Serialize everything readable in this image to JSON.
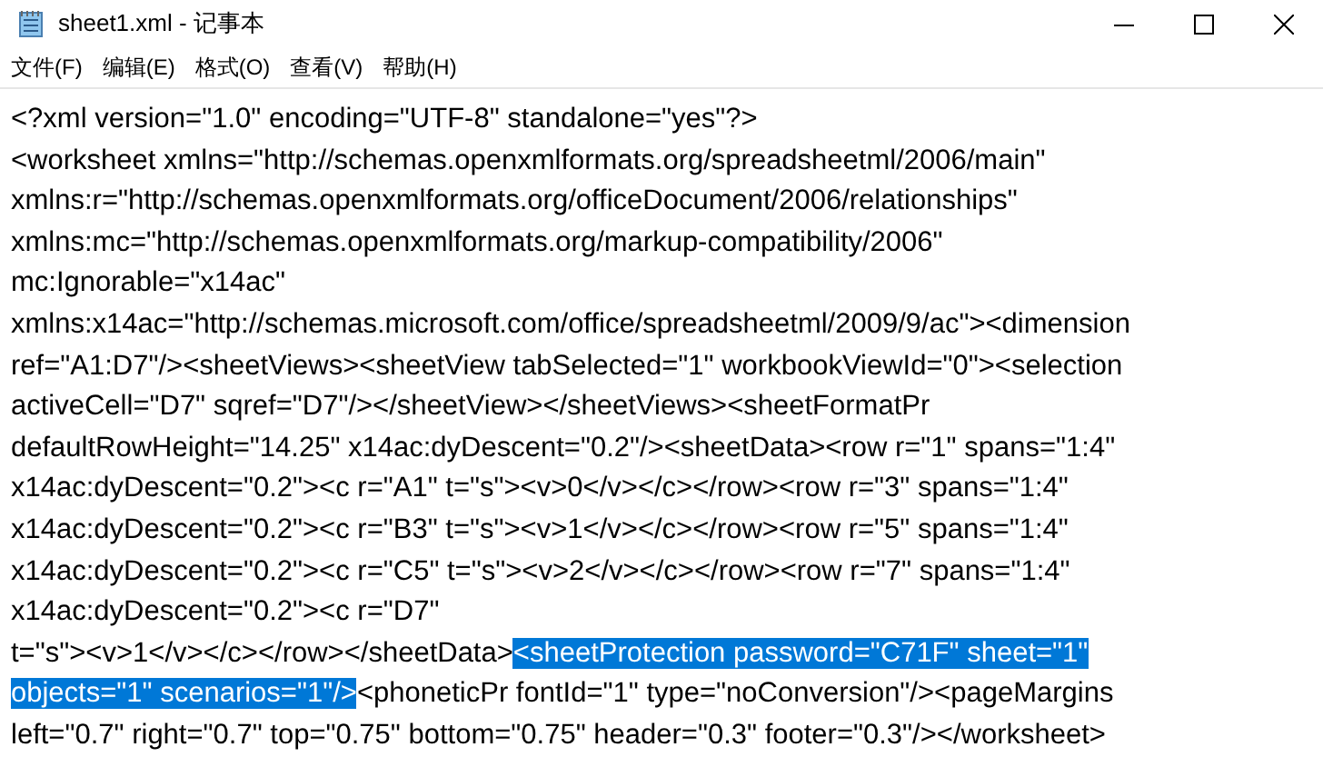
{
  "window": {
    "title": "sheet1.xml - 记事本"
  },
  "menu": [
    {
      "label": "文件(F)"
    },
    {
      "label": "编辑(E)"
    },
    {
      "label": "格式(O)"
    },
    {
      "label": "查看(V)"
    },
    {
      "label": "帮助(H)"
    }
  ],
  "lines": [
    [
      {
        "text": "<?xml version=\"1.0\" encoding=\"UTF-8\" standalone=\"yes\"?>",
        "selected": false
      }
    ],
    [
      {
        "text": "<worksheet xmlns=\"http://schemas.openxmlformats.org/spreadsheetml/2006/main\"",
        "selected": false
      }
    ],
    [
      {
        "text": "xmlns:r=\"http://schemas.openxmlformats.org/officeDocument/2006/relationships\"",
        "selected": false
      }
    ],
    [
      {
        "text": "xmlns:mc=\"http://schemas.openxmlformats.org/markup-compatibility/2006\"",
        "selected": false
      }
    ],
    [
      {
        "text": "mc:Ignorable=\"x14ac\"",
        "selected": false
      }
    ],
    [
      {
        "text": "xmlns:x14ac=\"http://schemas.microsoft.com/office/spreadsheetml/2009/9/ac\"><dimension",
        "selected": false
      }
    ],
    [
      {
        "text": "ref=\"A1:D7\"/><sheetViews><sheetView tabSelected=\"1\" workbookViewId=\"0\"><selection",
        "selected": false
      }
    ],
    [
      {
        "text": "activeCell=\"D7\" sqref=\"D7\"/></sheetView></sheetViews><sheetFormatPr",
        "selected": false
      }
    ],
    [
      {
        "text": "defaultRowHeight=\"14.25\" x14ac:dyDescent=\"0.2\"/><sheetData><row r=\"1\" spans=\"1:4\"",
        "selected": false
      }
    ],
    [
      {
        "text": "x14ac:dyDescent=\"0.2\"><c r=\"A1\" t=\"s\"><v>0</v></c></row><row r=\"3\" spans=\"1:4\"",
        "selected": false
      }
    ],
    [
      {
        "text": "x14ac:dyDescent=\"0.2\"><c r=\"B3\" t=\"s\"><v>1</v></c></row><row r=\"5\" spans=\"1:4\"",
        "selected": false
      }
    ],
    [
      {
        "text": "x14ac:dyDescent=\"0.2\"><c r=\"C5\" t=\"s\"><v>2</v></c></row><row r=\"7\" spans=\"1:4\"",
        "selected": false
      }
    ],
    [
      {
        "text": "x14ac:dyDescent=\"0.2\"><c r=\"D7\"",
        "selected": false
      }
    ],
    [
      {
        "text": "t=\"s\"><v>1</v></c></row></sheetData>",
        "selected": false
      },
      {
        "text": "<sheetProtection password=\"C71F\" sheet=\"1\"",
        "selected": true
      }
    ],
    [
      {
        "text": "objects=\"1\" scenarios=\"1\"/>",
        "selected": true
      },
      {
        "text": "<phoneticPr fontId=\"1\" type=\"noConversion\"/><pageMargins",
        "selected": false
      }
    ],
    [
      {
        "text": "left=\"0.7\" right=\"0.7\" top=\"0.75\" bottom=\"0.75\" header=\"0.3\" footer=\"0.3\"/></worksheet>",
        "selected": false
      }
    ]
  ]
}
